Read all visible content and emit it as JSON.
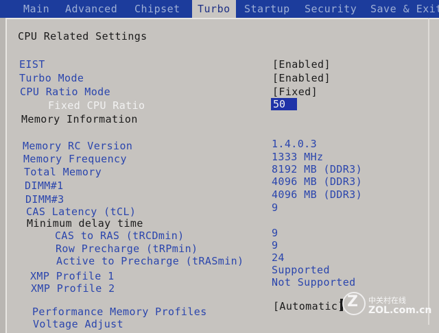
{
  "tabs": [
    {
      "label": "Main"
    },
    {
      "label": "Advanced"
    },
    {
      "label": "Chipset"
    },
    {
      "label": "Turbo"
    },
    {
      "label": "Startup"
    },
    {
      "label": "Security"
    },
    {
      "label": "Save & Exit"
    }
  ],
  "active_tab": "Turbo",
  "section_title": "CPU Related Settings",
  "settings": {
    "eist": {
      "label": "EIST",
      "value": "[Enabled]"
    },
    "turbo_mode": {
      "label": "Turbo Mode",
      "value": "[Enabled]"
    },
    "cpu_ratio_mode": {
      "label": "CPU Ratio Mode",
      "value": "[Fixed]"
    },
    "fixed_cpu_ratio": {
      "label": "Fixed CPU Ratio",
      "value": "50"
    },
    "memory_information": {
      "label": "Memory Information"
    },
    "memory_rc_version": {
      "label": "Memory RC Version",
      "value": "1.4.0.3"
    },
    "memory_frequency": {
      "label": "Memory Frequency",
      "value": "1333 MHz"
    },
    "total_memory": {
      "label": "Total Memory",
      "value": "8192 MB (DDR3)"
    },
    "dimm1": {
      "label": "DIMM#1",
      "value": "4096 MB (DDR3)"
    },
    "dimm3": {
      "label": "DIMM#3",
      "value": "4096 MB (DDR3)"
    },
    "cas_latency": {
      "label": "CAS Latency (tCL)",
      "value": "9"
    },
    "minimum_delay_time": {
      "label": "Minimum delay time"
    },
    "cas_to_ras": {
      "label": "CAS to RAS (tRCDmin)",
      "value": "9"
    },
    "row_precharge": {
      "label": "Row Precharge (tRPmin)",
      "value": "9"
    },
    "active_to_precharge": {
      "label": "Active to Precharge (tRASmin)",
      "value": "24"
    },
    "xmp_profile_1": {
      "label": "XMP Profile 1",
      "value": "Supported"
    },
    "xmp_profile_2": {
      "label": "XMP Profile 2",
      "value": "Not Supported"
    },
    "performance_memory_profiles": {
      "label": "Performance Memory Profiles",
      "value": "[Automatic]"
    },
    "voltage_adjust": {
      "label": "Voltage Adjust"
    }
  },
  "watermark": {
    "logo_letter": "Z",
    "text_cn": "中关村在线",
    "url": "ZOL.com.cn"
  },
  "colors": {
    "background": "#c6c3bf",
    "tab_bar": "#1c3c9c",
    "label_blue": "#2a45ad",
    "highlight": "#1f33a8"
  }
}
